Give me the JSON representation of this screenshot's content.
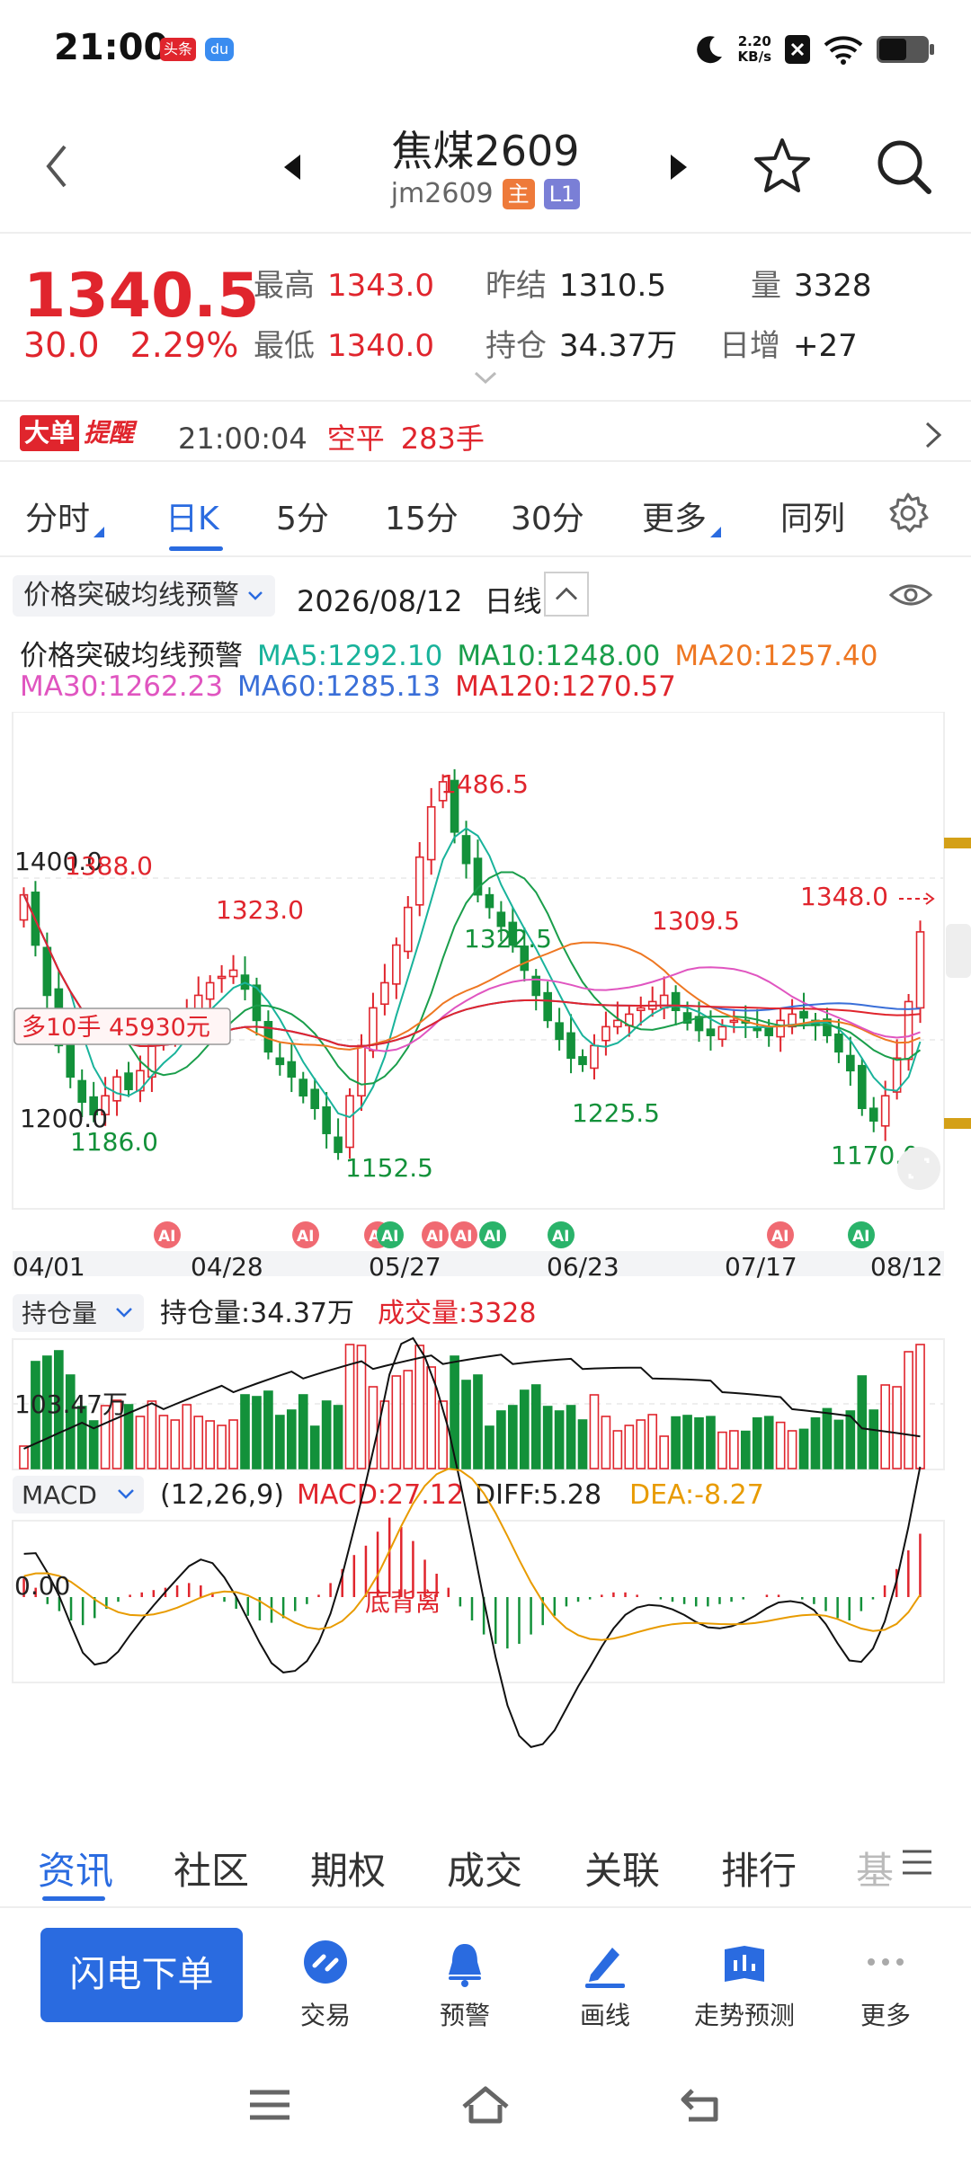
{
  "status_bar": {
    "time": "21:00",
    "badge1": "头条",
    "badge2": "du",
    "net_speed": "2.20",
    "net_unit": "KB/s"
  },
  "header": {
    "title": "焦煤2609",
    "code": "jm2609",
    "tag_main": "主",
    "tag_level": "L1"
  },
  "quote": {
    "price": "1340.5",
    "change": "30.0",
    "change_pct": "2.29%",
    "high_label": "最高",
    "high": "1343.0",
    "low_label": "最低",
    "low": "1340.0",
    "prev_settle_label": "昨结",
    "prev_settle": "1310.5",
    "oi_label": "持仓",
    "oi": "34.37万",
    "volume_label": "量",
    "volume": "3328",
    "daily_inc_label": "日增",
    "daily_inc": "+27"
  },
  "alert": {
    "badge_left": "大单",
    "badge_right": "提醒",
    "time": "21:00:04",
    "action": "空平",
    "lots": "283手"
  },
  "period_tabs": [
    {
      "label": "分时"
    },
    {
      "label": "日K"
    },
    {
      "label": "5分"
    },
    {
      "label": "15分"
    },
    {
      "label": "30分"
    },
    {
      "label": "更多"
    },
    {
      "label": "同列"
    }
  ],
  "indicator": {
    "selector": "价格突破均线预警",
    "date": "2026/08/12",
    "period": "日线",
    "name": "价格突破均线预警",
    "ma": [
      {
        "label": "MA5:1292.10",
        "color": "#19b39b"
      },
      {
        "label": "MA10:1248.00",
        "color": "#1a9e4b"
      },
      {
        "label": "MA20:1257.40",
        "color": "#ee7722"
      },
      {
        "label": "MA30:1262.23",
        "color": "#e055c0"
      },
      {
        "label": "MA60:1285.13",
        "color": "#3a6fd8"
      },
      {
        "label": "MA120:1270.57",
        "color": "#e0252d"
      }
    ]
  },
  "main_chart": {
    "y_labels": [
      "1400.0",
      "1200.0"
    ],
    "annotations": [
      {
        "text": "1388.0",
        "color": "red"
      },
      {
        "text": "1486.5",
        "color": "red"
      },
      {
        "text": "1323.0",
        "color": "red"
      },
      {
        "text": "1322.5",
        "color": "green"
      },
      {
        "text": "1309.5",
        "color": "red"
      },
      {
        "text": "1348.0",
        "color": "red"
      },
      {
        "text": "1186.0",
        "color": "green"
      },
      {
        "text": "1152.5",
        "color": "green"
      },
      {
        "text": "1225.5",
        "color": "green"
      },
      {
        "text": "1170.0",
        "color": "green"
      }
    ],
    "position_label": "多10手  45930元",
    "ai_badge": "AI",
    "x_labels": [
      "04/01",
      "04/28",
      "05/27",
      "06/23",
      "07/17",
      "08/12"
    ]
  },
  "volume_panel": {
    "selector": "持仓量",
    "oi_text": "持仓量:34.37万",
    "vol_text": "成交量:3328",
    "y_label": "103.47万"
  },
  "macd_panel": {
    "selector": "MACD",
    "params": "(12,26,9)",
    "macd": "MACD:27.12",
    "diff": "DIFF:5.28",
    "dea": "DEA:-8.27",
    "y_label": "0.00",
    "divergence_label": "底背离"
  },
  "bottom_tabs": [
    {
      "label": "资讯"
    },
    {
      "label": "社区"
    },
    {
      "label": "期权"
    },
    {
      "label": "成交"
    },
    {
      "label": "关联"
    },
    {
      "label": "排行"
    },
    {
      "label": "基"
    }
  ],
  "actions": {
    "flash_order": "闪电下单",
    "trade": "交易",
    "alert": "预警",
    "draw": "画线",
    "forecast": "走势预测",
    "more": "更多"
  },
  "colors": {
    "up": "#e0252d",
    "down": "#13913a",
    "accent": "#2a6be0"
  },
  "chart_data": {
    "type": "candlestick",
    "x_labels": [
      "04/01",
      "04/28",
      "05/27",
      "06/23",
      "07/17",
      "08/12"
    ],
    "y_ticks": [
      1200.0,
      1400.0
    ],
    "marked_highs": [
      1388.0,
      1323.0,
      1486.5,
      1309.5,
      1348.0
    ],
    "marked_lows": [
      1186.0,
      1152.5,
      1322.5,
      1225.5,
      1170.0
    ],
    "closes": [
      1370,
      1330,
      1290,
      1250,
      1225,
      1205,
      1195,
      1210,
      1225,
      1215,
      1230,
      1250,
      1260,
      1265,
      1275,
      1290,
      1300,
      1305,
      1310,
      1295,
      1270,
      1245,
      1235,
      1225,
      1210,
      1200,
      1180,
      1165,
      1210,
      1250,
      1280,
      1300,
      1330,
      1360,
      1400,
      1440,
      1460,
      1420,
      1395,
      1370,
      1360,
      1345,
      1330,
      1310,
      1290,
      1270,
      1255,
      1240,
      1235,
      1250,
      1265,
      1270,
      1275,
      1280,
      1285,
      1290,
      1278,
      1268,
      1262,
      1258,
      1265,
      1270,
      1268,
      1262,
      1258,
      1270,
      1275,
      1272,
      1266,
      1258,
      1245,
      1230,
      1200,
      1190,
      1210,
      1240,
      1285,
      1340.5
    ],
    "macd_hist": [
      8,
      4,
      -3,
      -6,
      -10,
      -12,
      -9,
      -5,
      -2,
      1,
      2,
      3,
      4,
      5,
      6,
      5,
      2,
      -2,
      -5,
      -8,
      -10,
      -11,
      -9,
      -6,
      -3,
      1,
      6,
      12,
      18,
      22,
      28,
      34,
      30,
      24,
      16,
      10,
      4,
      -4,
      -10,
      -16,
      -20,
      -22,
      -20,
      -16,
      -12,
      -8,
      -4,
      -2,
      -1,
      1,
      2,
      2,
      1,
      0,
      -1,
      -2,
      -3,
      -4,
      -4,
      -3,
      -2,
      -1,
      0,
      1,
      1,
      0,
      -1,
      -3,
      -6,
      -9,
      -10,
      -6,
      -1,
      5,
      12,
      20,
      27.12
    ],
    "ylim": [
      1120,
      1510
    ]
  }
}
